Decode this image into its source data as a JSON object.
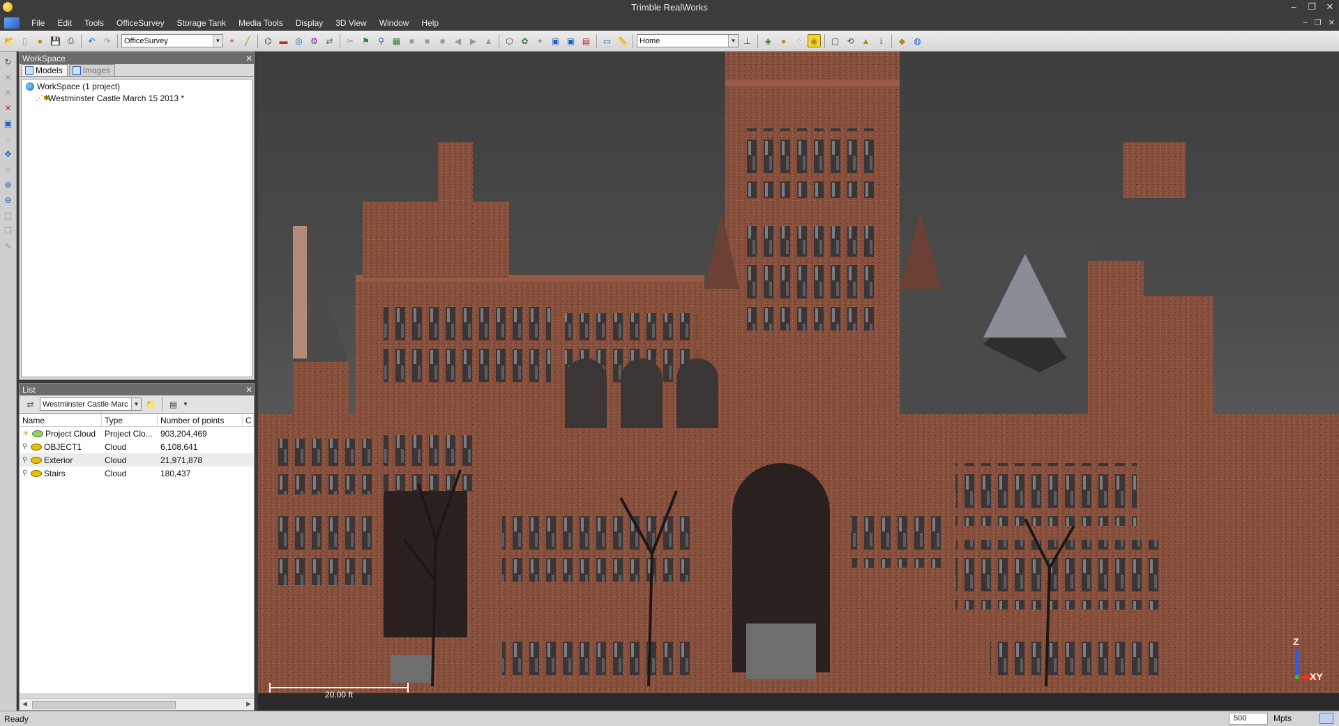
{
  "window": {
    "title": "Trimble RealWorks"
  },
  "menu": {
    "items": [
      "File",
      "Edit",
      "Tools",
      "OfficeSurvey",
      "Storage Tank",
      "Media Tools",
      "Display",
      "3D View",
      "Window",
      "Help"
    ]
  },
  "toolbar": {
    "mode_combo": "OfficeSurvey",
    "view_combo": "Home"
  },
  "workspace": {
    "title": "WorkSpace",
    "tabs": [
      "Models",
      "Images"
    ],
    "root": "WorkSpace  (1 project)",
    "project": "Westminster Castle March 15 2013  *"
  },
  "list": {
    "title": "List",
    "combo": "Westminster Castle Marc",
    "columns": [
      "Name",
      "Type",
      "Number of points",
      "C"
    ],
    "rows": [
      {
        "name": "Project Cloud",
        "type": "Project Clo...",
        "points": "903,204,469"
      },
      {
        "name": "OBJECT1",
        "type": "Cloud",
        "points": "6,108,641"
      },
      {
        "name": "Exterior",
        "type": "Cloud",
        "points": "21,971,878"
      },
      {
        "name": "Stairs",
        "type": "Cloud",
        "points": "180,437"
      }
    ]
  },
  "view": {
    "scale_label": "20.00 ft",
    "axis_z": "Z",
    "axis_xy": "XY"
  },
  "status": {
    "text": "Ready",
    "points": "500",
    "unit": "Mpts"
  },
  "colors": {
    "brick": "#8a4f3c",
    "background_top": "#3e3e3e",
    "panel_header": "#6b6b6b"
  }
}
